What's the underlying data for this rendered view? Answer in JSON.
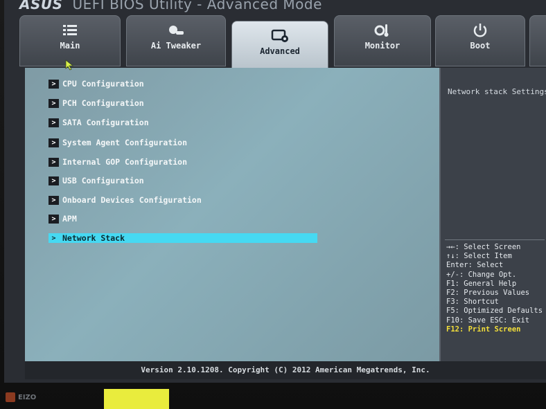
{
  "window": {
    "logo": "ASUS",
    "title": "UEFI BIOS Utility - Advanced Mode"
  },
  "tabs": [
    {
      "label": "Main",
      "icon": "list-icon",
      "active": false
    },
    {
      "label": "Ai Tweaker",
      "icon": "tweaker-icon",
      "active": false
    },
    {
      "label": "Advanced",
      "icon": "advanced-icon",
      "active": true
    },
    {
      "label": "Monitor",
      "icon": "monitor-icon",
      "active": false
    },
    {
      "label": "Boot",
      "icon": "power-icon",
      "active": false
    }
  ],
  "menu": {
    "items": [
      {
        "label": "CPU Configuration"
      },
      {
        "label": "PCH Configuration"
      },
      {
        "label": "SATA Configuration"
      },
      {
        "label": "System Agent Configuration"
      },
      {
        "label": "Internal GOP Configuration"
      },
      {
        "label": "USB Configuration"
      },
      {
        "label": "Onboard Devices Configuration"
      },
      {
        "label": "APM"
      },
      {
        "label": "Network Stack",
        "selected": true
      }
    ]
  },
  "help": {
    "description": "Network stack Settings",
    "keys": [
      "→←: Select Screen",
      "↑↓: Select Item",
      "Enter: Select",
      "+/-: Change Opt.",
      "F1: General Help",
      "F2: Previous Values",
      "F3: Shortcut",
      "F5: Optimized Defaults",
      "F10: Save  ESC: Exit",
      "F12: Print Screen"
    ]
  },
  "footer": {
    "version": "Version 2.10.1208. Copyright (C) 2012 American Megatrends, Inc."
  },
  "bezel": {
    "brand": "EIZO"
  },
  "colors": {
    "panel": "#8bb0bb",
    "selection": "#46d9f2",
    "highlight_key": "#f3df3a"
  }
}
